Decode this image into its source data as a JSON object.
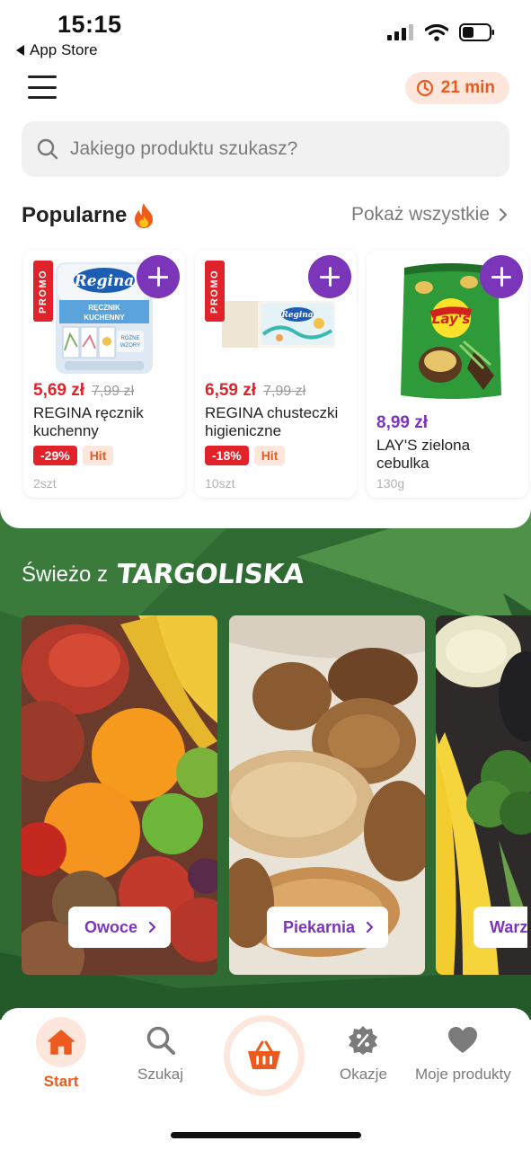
{
  "status_bar": {
    "time": "15:15",
    "back_app": "App Store"
  },
  "header": {
    "eta": "21 min"
  },
  "search": {
    "placeholder": "Jakiego produktu szukasz?"
  },
  "popular": {
    "title": "Popularne",
    "show_all": "Pokaż wszystkie",
    "products": [
      {
        "promo_tag": "PROMO",
        "price": "5,69 zł",
        "old_price": "7,99 zł",
        "name": "REGINA ręcznik kuchenny",
        "discount": "-29%",
        "badge": "Hit",
        "quantity": "2szt",
        "brand": "Regina",
        "pack_text": "RĘCZNIK KUCHENNY"
      },
      {
        "promo_tag": "PROMO",
        "price": "6,59 zł",
        "old_price": "7,99 zł",
        "name": "REGINA chusteczki higieniczne",
        "discount": "-18%",
        "badge": "Hit",
        "quantity": "10szt",
        "brand": "Regina"
      },
      {
        "price": "8,99 zł",
        "name": "LAY'S zielona cebulka",
        "quantity": "130g",
        "brand": "Lay's"
      }
    ]
  },
  "fresh": {
    "title_prefix": "Świeżo z",
    "brand": "TARGOLISKA",
    "categories": [
      {
        "label": "Owoce"
      },
      {
        "label": "Piekarnia"
      },
      {
        "label": "Warz"
      }
    ]
  },
  "bottom_nav": {
    "start": "Start",
    "search": "Szukaj",
    "deals": "Okazje",
    "my_products": "Moje produkty"
  },
  "colors": {
    "accent_orange": "#ec5a1f",
    "accent_purple": "#7b35b9",
    "promo_red": "#e0232a",
    "fresh_green": "#2e6a32"
  }
}
